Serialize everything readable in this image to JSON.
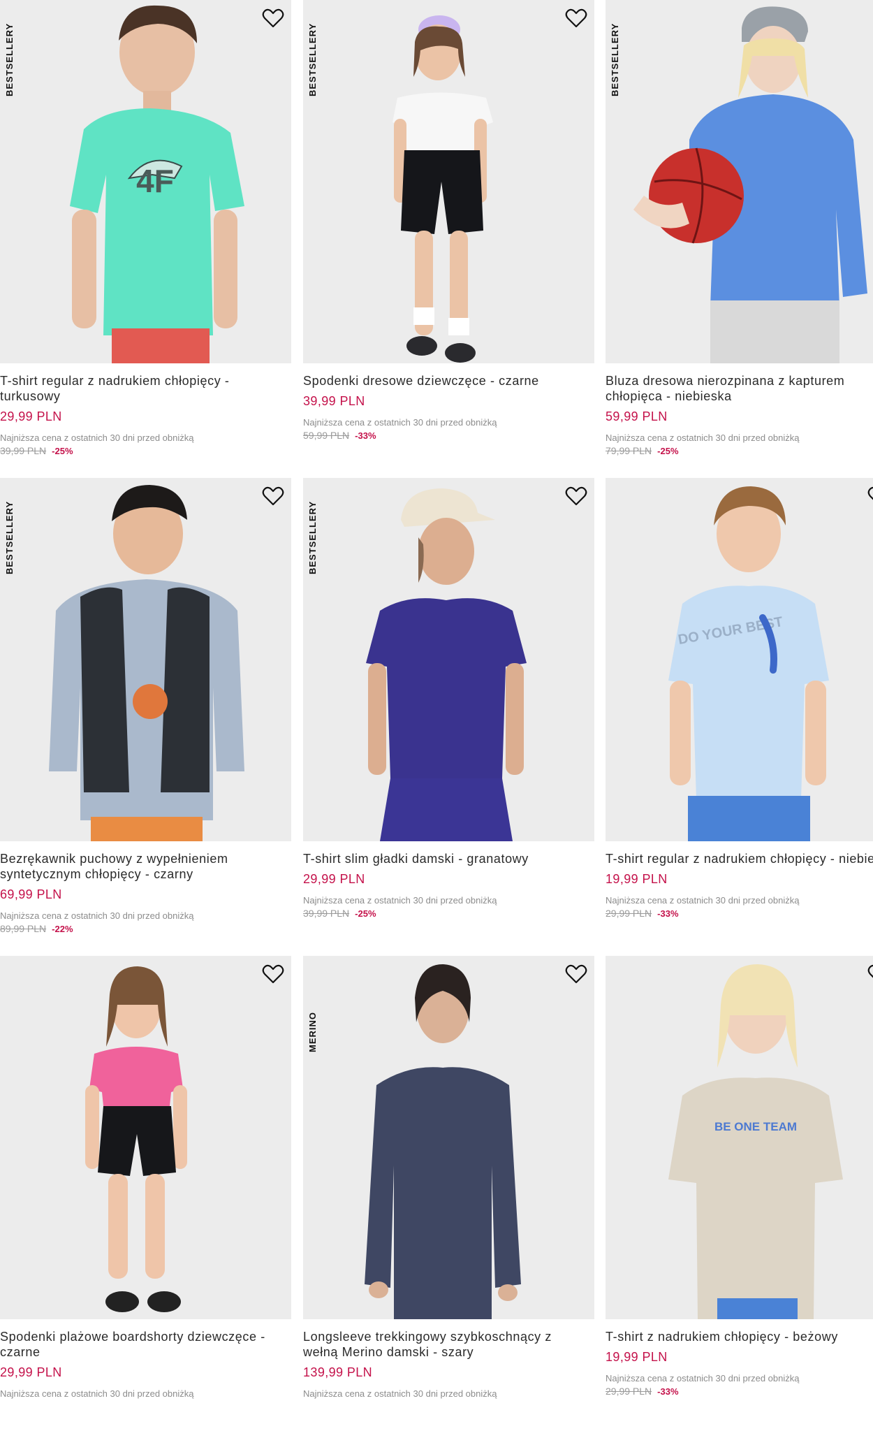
{
  "products": [
    {
      "badge": "BESTSELLERY",
      "title": "T-shirt regular z nadrukiem chłopięcy - turkusowy",
      "price": "29,99 PLN",
      "lowest_label": "Najniższa cena z ostatnich 30 dni przed obniżką",
      "old_price": "39,99 PLN",
      "discount": "-25%",
      "graphic_text": "4F"
    },
    {
      "badge": "BESTSELLERY",
      "title": "Spodenki dresowe dziewczęce - czarne",
      "price": "39,99 PLN",
      "lowest_label": "Najniższa cena z ostatnich 30 dni przed obniżką",
      "old_price": "59,99 PLN",
      "discount": "-33%"
    },
    {
      "badge": "BESTSELLERY",
      "title": "Bluza dresowa nierozpinana z kapturem chłopięca - niebieska",
      "price": "59,99 PLN",
      "lowest_label": "Najniższa cena z ostatnich 30 dni przed obniżką",
      "old_price": "79,99 PLN",
      "discount": "-25%"
    },
    {
      "badge": "BESTSELLERY",
      "title": "Bezrękawnik puchowy z wypełnieniem syntetycznym chłopięcy - czarny",
      "price": "69,99 PLN",
      "lowest_label": "Najniższa cena z ostatnich 30 dni przed obniżką",
      "old_price": "89,99 PLN",
      "discount": "-22%"
    },
    {
      "badge": "BESTSELLERY",
      "title": "T-shirt slim gładki damski - granatowy",
      "price": "29,99 PLN",
      "lowest_label": "Najniższa cena z ostatnich 30 dni przed obniżką",
      "old_price": "39,99 PLN",
      "discount": "-25%"
    },
    {
      "badge": "",
      "title": "T-shirt regular z nadrukiem chłopięcy - niebieski",
      "price": "19,99 PLN",
      "lowest_label": "Najniższa cena z ostatnich 30 dni przed obniżką",
      "old_price": "29,99 PLN",
      "discount": "-33%",
      "graphic_text": "DO YOUR BEST"
    },
    {
      "badge": "",
      "title": "Spodenki plażowe boardshorty dziewczęce - czarne",
      "price": "29,99 PLN",
      "lowest_label": "Najniższa cena z ostatnich 30 dni przed obniżką",
      "old_price": "",
      "discount": ""
    },
    {
      "badge": "MERINO",
      "title": "Longsleeve trekkingowy szybkoschnący z wełną Merino damski - szary",
      "price": "139,99 PLN",
      "lowest_label": "Najniższa cena z ostatnich 30 dni przed obniżką",
      "old_price": "",
      "discount": ""
    },
    {
      "badge": "",
      "title": "T-shirt z nadrukiem chłopięcy - beżowy",
      "price": "19,99 PLN",
      "lowest_label": "Najniższa cena z ostatnich 30 dni przed obniżką",
      "old_price": "29,99 PLN",
      "discount": "-33%",
      "graphic_text": "BE ONE TEAM"
    }
  ],
  "colors": {
    "price": "#c4114a",
    "photo_bg": "#ececec",
    "tee_turquoise": "#5fe3c4",
    "tee_white": "#f7f7f7",
    "hoodie_blue": "#5b8fe0",
    "vest_black": "#2c3036",
    "tee_navy": "#3a338f",
    "tee_lightblue": "#c6def5",
    "tee_pink": "#f0629b",
    "longsleeve_gray": "#3f4763",
    "tee_beige": "#ddd5c6"
  },
  "icons": {
    "favorite": "heart-outline-icon"
  }
}
